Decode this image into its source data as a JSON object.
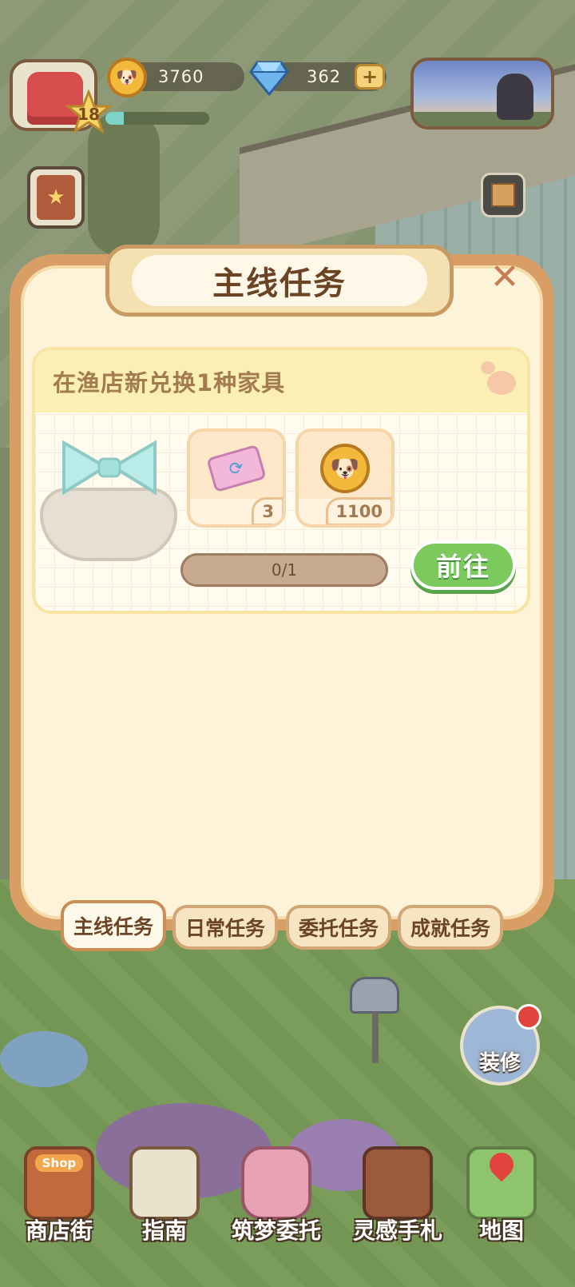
{
  "header": {
    "level": "18",
    "xp_fraction": 0.18,
    "coins": "3760",
    "gems": "362",
    "add_label": "+"
  },
  "panel": {
    "title": "主线任务",
    "close_label": "✕",
    "task": {
      "description": "在渔店新兑换1种家具",
      "rewards": [
        {
          "icon": "ticket-icon",
          "qty": "3"
        },
        {
          "icon": "corgi-coin-icon",
          "qty": "1100"
        }
      ],
      "progress_text": "0/1",
      "progress_fraction": 0,
      "go_label": "前往"
    },
    "tabs": [
      "主线任务",
      "日常任务",
      "委托任务",
      "成就任务"
    ],
    "active_tab": 0
  },
  "side": {
    "decorate_label": "装修"
  },
  "bottom_nav": [
    "商店街",
    "指南",
    "筑梦委托",
    "灵感手札",
    "地图"
  ],
  "shop_sign": "Shop",
  "colors": {
    "panel_border": "#d99e66",
    "panel_bg": "#fdf3d9",
    "go_button": "#7cc95e",
    "title_text": "#6b4426"
  }
}
